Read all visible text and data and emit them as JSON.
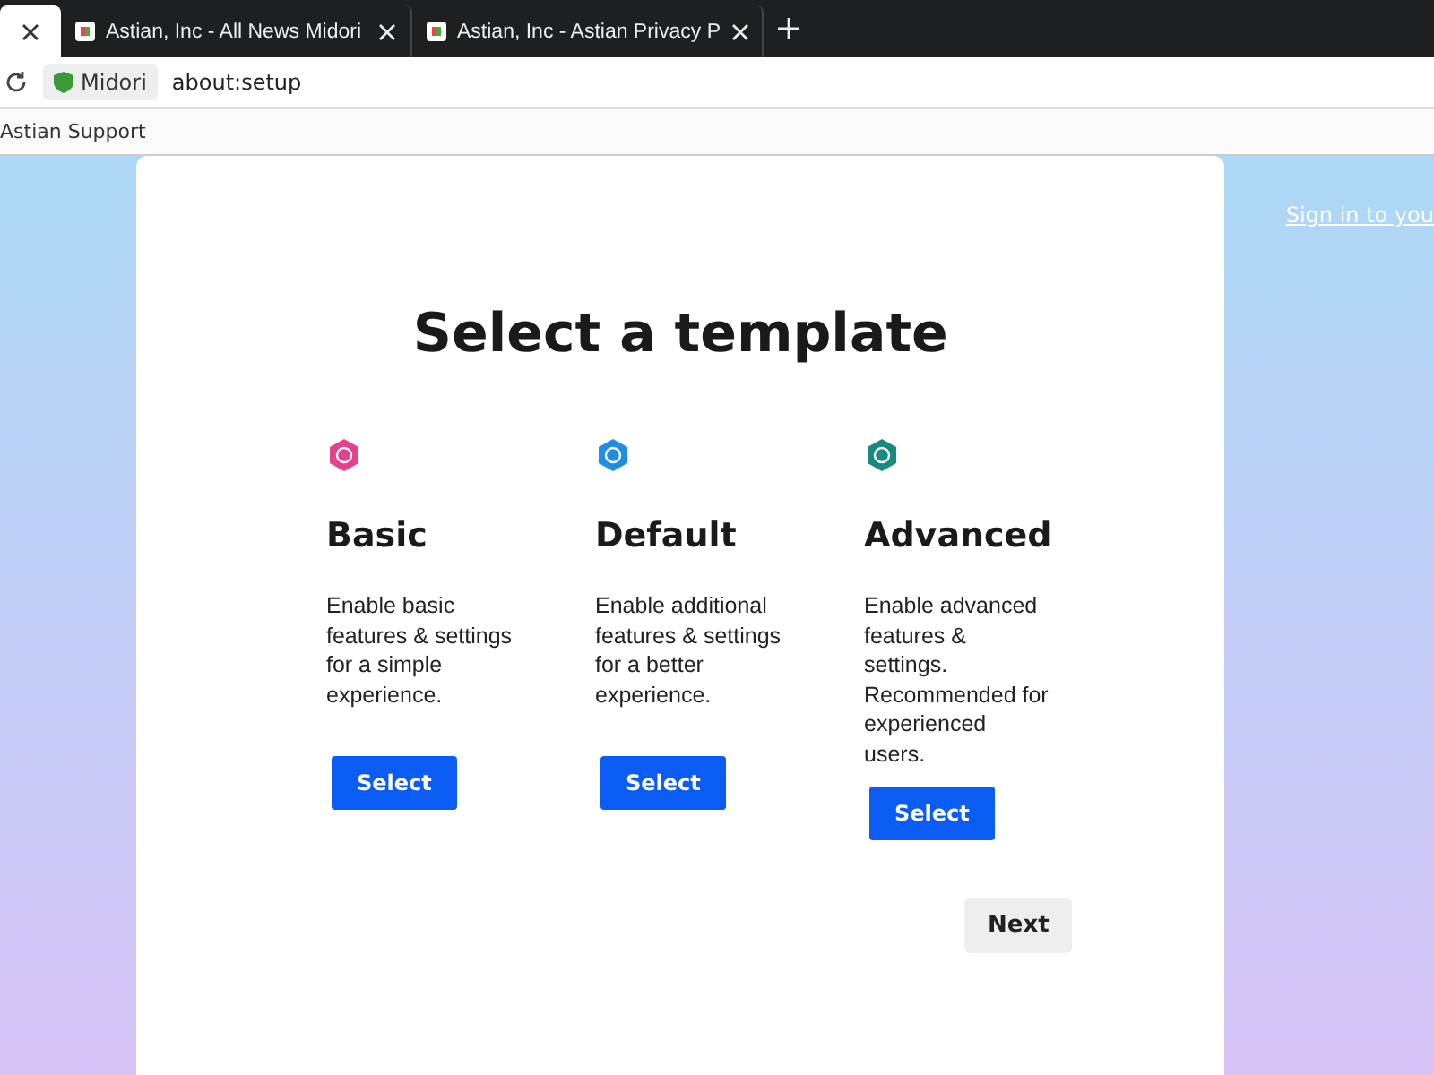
{
  "tabs": [
    {
      "selected": true
    },
    {
      "title": "Astian, Inc - All News Midori",
      "selected": false
    },
    {
      "title": "Astian, Inc - Astian Privacy P",
      "selected": false
    }
  ],
  "address_bar": {
    "site_label": "Midori",
    "url": "about:setup"
  },
  "bookmarks": [
    "Astian Support"
  ],
  "sign_in_link": "Sign in to you",
  "page": {
    "title": "Select a template",
    "templates": [
      {
        "name": "Basic",
        "description": "Enable basic features & settings for a simple experience.",
        "button": "Select",
        "color": "#e8408a"
      },
      {
        "name": "Default",
        "description": "Enable additional features & settings for a better experience.",
        "button": "Select",
        "color": "#1f8de6"
      },
      {
        "name": "Advanced",
        "description": "Enable advanced features & settings. Recommended for experienced users.",
        "button": "Select",
        "color": "#1b8a7e"
      }
    ],
    "next_button": "Next"
  }
}
